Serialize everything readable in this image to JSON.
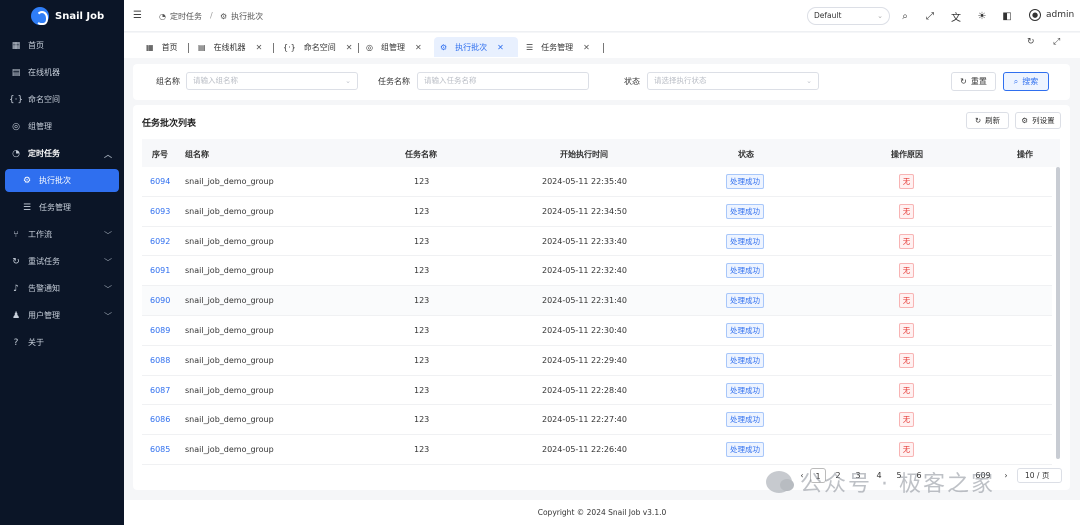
{
  "app": {
    "title": "Snail Job"
  },
  "sidebar": {
    "items": [
      {
        "label": "首页",
        "icon": "grid-icon"
      },
      {
        "label": "在线机器",
        "icon": "server-icon"
      },
      {
        "label": "命名空间",
        "icon": "namespace-icon"
      },
      {
        "label": "组管理",
        "icon": "group-icon"
      },
      {
        "label": "定时任务",
        "icon": "clock-icon",
        "expanded": true
      },
      {
        "label": "执行批次",
        "icon": "batch-icon",
        "active": true
      },
      {
        "label": "任务管理",
        "icon": "task-list-icon"
      },
      {
        "label": "工作流",
        "icon": "workflow-icon"
      },
      {
        "label": "重试任务",
        "icon": "retry-icon"
      },
      {
        "label": "告警通知",
        "icon": "bell-icon"
      },
      {
        "label": "用户管理",
        "icon": "users-icon"
      },
      {
        "label": "关于",
        "icon": "help-icon"
      }
    ]
  },
  "header": {
    "breadcrumb": [
      "定时任务",
      "执行批次"
    ],
    "breadcrumb_sep": "/",
    "theme_select": "Default",
    "username": "admin"
  },
  "tabs": [
    {
      "label": "首页",
      "icon": "grid-icon"
    },
    {
      "label": "在线机器",
      "icon": "server-icon"
    },
    {
      "label": "命名空间",
      "icon": "namespace-icon"
    },
    {
      "label": "组管理",
      "icon": "group-icon"
    },
    {
      "label": "执行批次",
      "icon": "batch-icon",
      "active": true
    },
    {
      "label": "任务管理",
      "icon": "task-list-icon"
    }
  ],
  "search": {
    "group_label": "组名称",
    "group_placeholder": "请输入组名称",
    "task_label": "任务名称",
    "task_placeholder": "请输入任务名称",
    "status_label": "状态",
    "status_placeholder": "请选择执行状态",
    "reset_label": "重置",
    "search_label": "搜索"
  },
  "table": {
    "title": "任务批次列表",
    "refresh_label": "刷新",
    "columns_label": "列设置",
    "headers": [
      "序号",
      "组名称",
      "任务名称",
      "开始执行时间",
      "状态",
      "操作原因",
      "操作"
    ],
    "rows": [
      {
        "id": "6094",
        "group": "snail_job_demo_group",
        "task": "123",
        "start": "2024-05-11 22:35:40",
        "status": "处理成功",
        "reason": "无"
      },
      {
        "id": "6093",
        "group": "snail_job_demo_group",
        "task": "123",
        "start": "2024-05-11 22:34:50",
        "status": "处理成功",
        "reason": "无"
      },
      {
        "id": "6092",
        "group": "snail_job_demo_group",
        "task": "123",
        "start": "2024-05-11 22:33:40",
        "status": "处理成功",
        "reason": "无"
      },
      {
        "id": "6091",
        "group": "snail_job_demo_group",
        "task": "123",
        "start": "2024-05-11 22:32:40",
        "status": "处理成功",
        "reason": "无"
      },
      {
        "id": "6090",
        "group": "snail_job_demo_group",
        "task": "123",
        "start": "2024-05-11 22:31:40",
        "status": "处理成功",
        "reason": "无"
      },
      {
        "id": "6089",
        "group": "snail_job_demo_group",
        "task": "123",
        "start": "2024-05-11 22:30:40",
        "status": "处理成功",
        "reason": "无"
      },
      {
        "id": "6088",
        "group": "snail_job_demo_group",
        "task": "123",
        "start": "2024-05-11 22:29:40",
        "status": "处理成功",
        "reason": "无"
      },
      {
        "id": "6087",
        "group": "snail_job_demo_group",
        "task": "123",
        "start": "2024-05-11 22:28:40",
        "status": "处理成功",
        "reason": "无"
      },
      {
        "id": "6086",
        "group": "snail_job_demo_group",
        "task": "123",
        "start": "2024-05-11 22:27:40",
        "status": "处理成功",
        "reason": "无"
      },
      {
        "id": "6085",
        "group": "snail_job_demo_group",
        "task": "123",
        "start": "2024-05-11 22:26:40",
        "status": "处理成功",
        "reason": "无"
      }
    ]
  },
  "pagination": {
    "pages": [
      "1",
      "2",
      "3",
      "4",
      "5",
      "6"
    ],
    "current": "1",
    "last": "609",
    "page_size": "10 / 页"
  },
  "watermark": "公众号 · 极客之家",
  "footer": "Copyright © 2024 Snail Job v3.1.0",
  "colors": {
    "primary": "#2f6fef",
    "sidebar_bg": "#0b1527",
    "danger": "#e53935"
  }
}
